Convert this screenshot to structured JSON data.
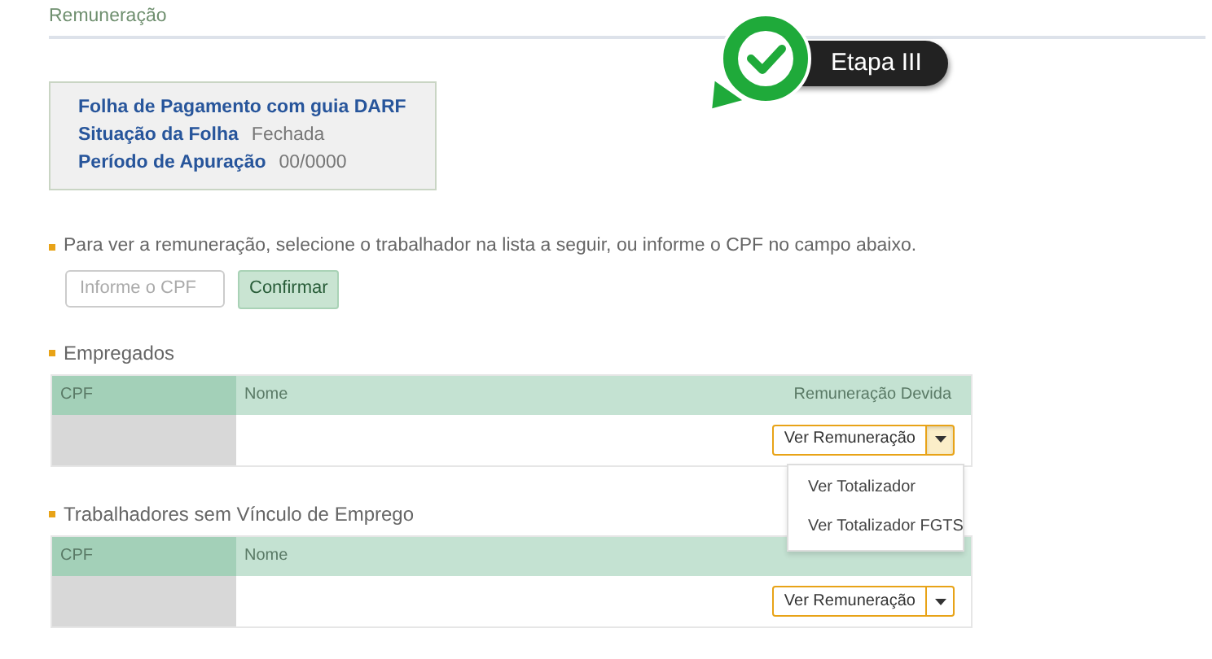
{
  "section_title": "Remuneração",
  "step_badge": {
    "label": "Etapa III"
  },
  "summary": {
    "title": "Folha de Pagamento com guia DARF",
    "fields": [
      {
        "label": "Situação da Folha",
        "value": "Fechada"
      },
      {
        "label": "Período de Apuração",
        "value": "00/0000"
      }
    ]
  },
  "instruction": "Para ver a remuneração, selecione o trabalhador na lista a seguir, ou informe o CPF no campo abaixo.",
  "cpf_field": {
    "placeholder": "Informe o CPF"
  },
  "confirm_button": "Confirmar",
  "tables": [
    {
      "heading": "Empregados",
      "columns": [
        "CPF",
        "Nome",
        "Remuneração Devida"
      ],
      "rows": [
        {
          "action": "Ver Remuneração",
          "expanded": true,
          "menu_items": [
            "Ver Totalizador",
            "Ver Totalizador FGTS"
          ]
        }
      ]
    },
    {
      "heading": "Trabalhadores sem Vínculo de Emprego",
      "columns": [
        "CPF",
        "Nome"
      ],
      "rows": [
        {
          "action": "Ver Remuneração",
          "expanded": false
        }
      ]
    }
  ]
}
